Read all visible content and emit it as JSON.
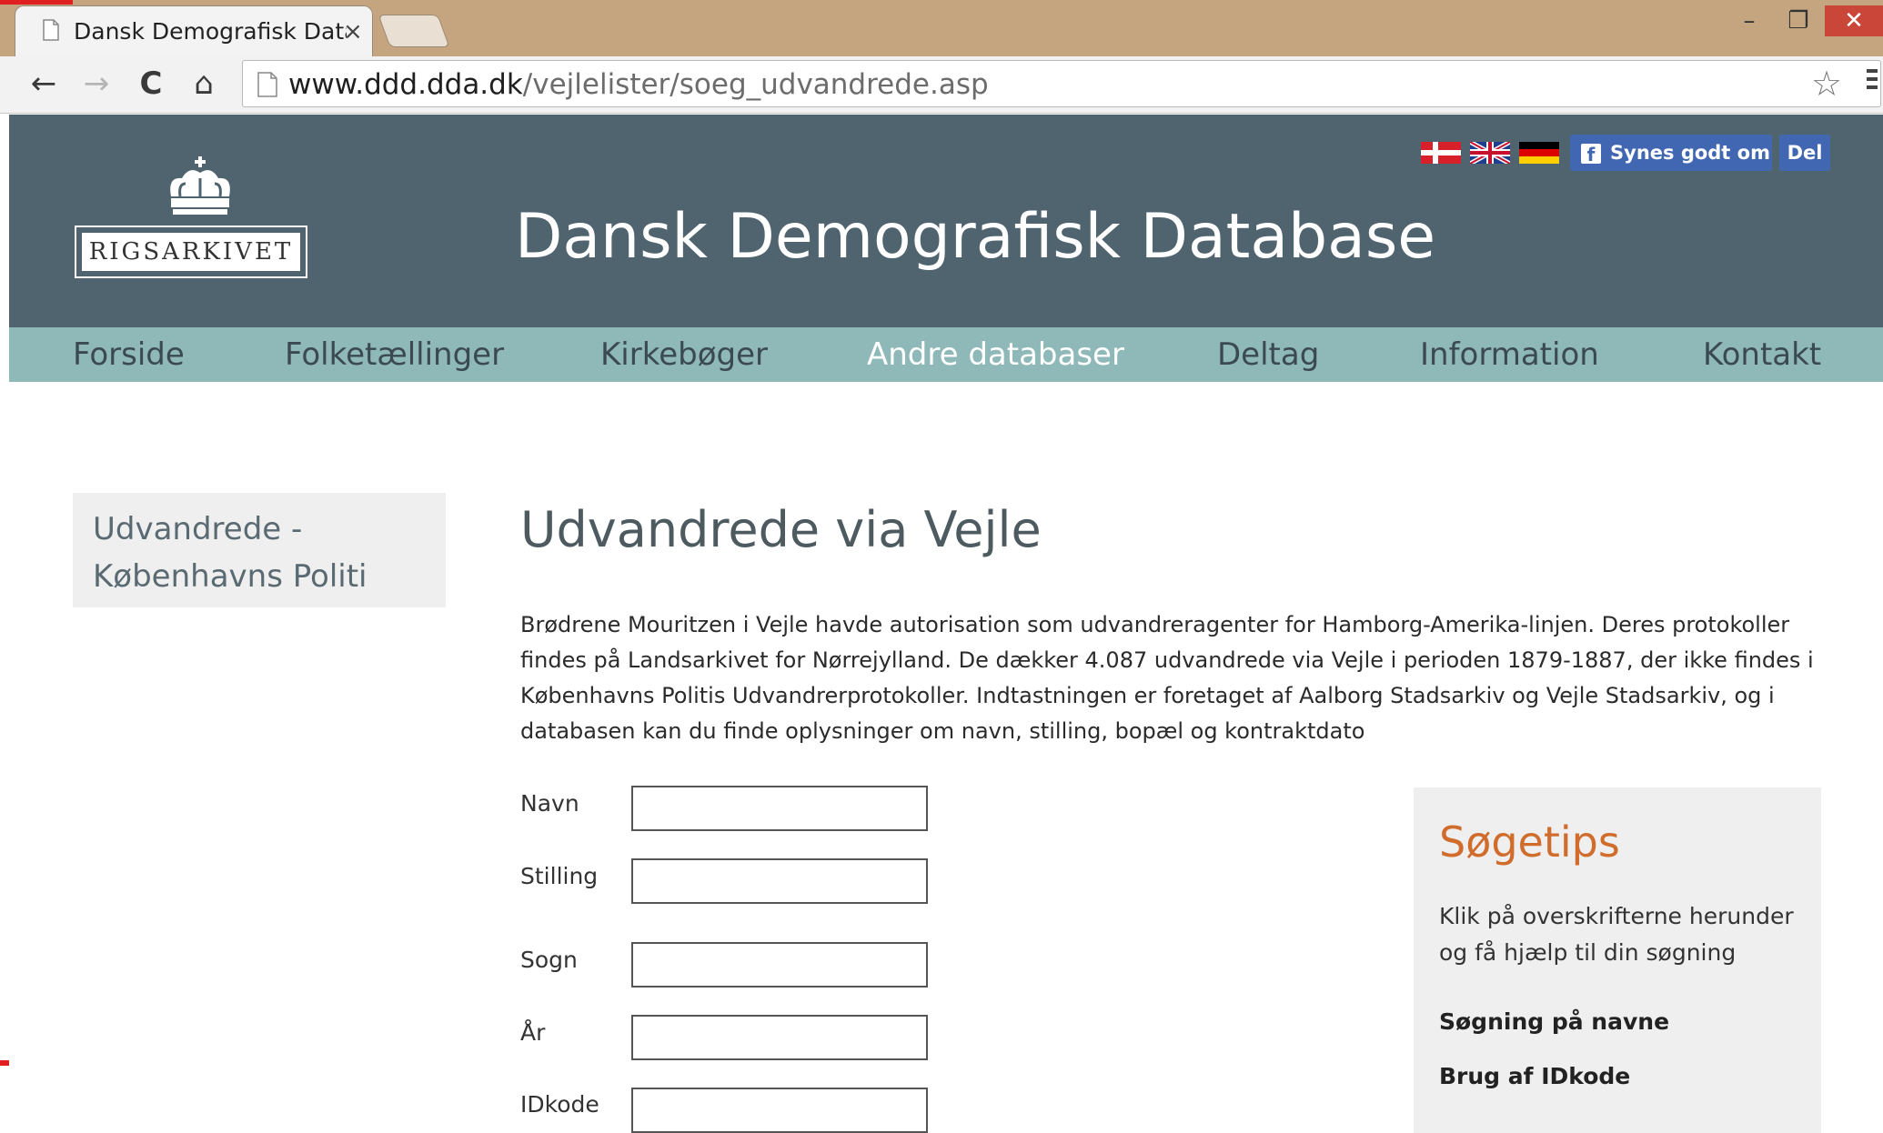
{
  "browser": {
    "tab_title": "Dansk Demografisk Datab",
    "tab_close": "×",
    "url_host": "www.ddd.dda.dk",
    "url_path": "/vejlelister/soeg_udvandrede.asp",
    "win_minimize": "–",
    "win_restore": "❐",
    "win_close": "✕",
    "back": "←",
    "forward": "→",
    "reload": "C",
    "home": "⌂",
    "star": "☆"
  },
  "header": {
    "logo_text": "RIGSARKIVET",
    "site_title": "Dansk Demografisk Database",
    "fb_like_label": "Synes godt om",
    "fb_share_label": "Del",
    "fb_icon": "f"
  },
  "nav": {
    "items": [
      {
        "label": "Forside"
      },
      {
        "label": "Folketællinger"
      },
      {
        "label": "Kirkebøger"
      },
      {
        "label": "Andre databaser"
      },
      {
        "label": "Deltag"
      },
      {
        "label": "Information"
      },
      {
        "label": "Kontakt"
      }
    ],
    "active_index": 3
  },
  "sidebar": {
    "link_label": "Udvandrede - Københavns Politi"
  },
  "main": {
    "heading": "Udvandrede via Vejle",
    "intro": "Brødrene Mouritzen i Vejle havde autorisation som udvandreragenter for Hamborg-Amerika-linjen. Deres protokoller findes på Landsarkivet for Nørrejylland. De dækker 4.087 udvandrede via Vejle i perioden 1879-1887, der ikke findes i Københavns Politis Udvandrerprotokoller. Indtastningen er foretaget af Aalborg Stadsarkiv og Vejle Stadsarkiv, og i databasen kan du finde oplysninger om navn, stilling, bopæl og kontraktdato"
  },
  "form": {
    "fields": [
      {
        "label": "Navn",
        "value": ""
      },
      {
        "label": "Stilling",
        "value": ""
      },
      {
        "label": "Sogn",
        "value": ""
      },
      {
        "label": "År",
        "value": ""
      },
      {
        "label": "IDkode",
        "value": ""
      }
    ]
  },
  "tips": {
    "title": "Søgetips",
    "text": "Klik på overskrifterne herunder og få hjælp til din søgning",
    "links": [
      {
        "label": "Søgning på navne"
      },
      {
        "label": "Brug af IDkode"
      }
    ]
  },
  "colors": {
    "header_bg": "#506470",
    "nav_bg": "#8fb8b8",
    "tips_title": "#d06d2c",
    "fb_blue": "#4267b2"
  }
}
